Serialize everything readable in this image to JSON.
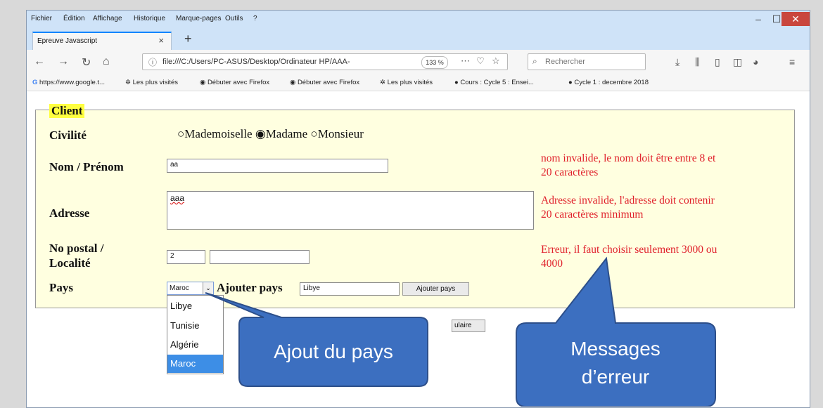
{
  "menubar": {
    "items": [
      "Fichier",
      "Édition",
      "Affichage",
      "Historique",
      "Marque-pages",
      "Outils",
      "?"
    ],
    "minimize": "–",
    "maximize": "☐",
    "close": "✕"
  },
  "tab": {
    "title": "Epreuve Javascript",
    "close": "×",
    "new_tab": "+"
  },
  "navbar": {
    "url": "file:///C:/Users/PC-ASUS/Desktop/Ordinateur HP/AAA-",
    "zoom": "133 %",
    "search_placeholder": "Rechercher"
  },
  "bookmarks": [
    "https://www.google.t...",
    "Les plus visités",
    "Débuter avec Firefox",
    "Débuter avec Firefox",
    "Les plus visités",
    "Cours : Cycle 5 : Ensei...",
    "Cycle 1 : decembre 2018"
  ],
  "form": {
    "legend": "Client",
    "civilite_label": "Civilité",
    "civilite_options": [
      {
        "label": "Mademoiselle",
        "checked": false
      },
      {
        "label": "Madame",
        "checked": true
      },
      {
        "label": "Monsieur",
        "checked": false
      }
    ],
    "nom_label": "Nom / Prénom",
    "nom_value": "aa",
    "adresse_label": "Adresse",
    "adresse_value": "aaa",
    "postal_label_1": "No postal /",
    "postal_label_2": "Localité",
    "postal_value": "2",
    "localite_value": "",
    "pays_label": "Pays",
    "pays_selected": "Maroc",
    "ajouter_label": "Ajouter pays",
    "ajouter_value": "Libye",
    "ajouter_button": "Ajouter pays",
    "submit_partial": "ulaire",
    "pays_options": [
      "Libye",
      "Tunisie",
      "Algérie",
      "Maroc"
    ]
  },
  "errors": {
    "nom_1": "nom invalide, le nom doit être entre 8 et",
    "nom_2": "20 caractères",
    "adresse_1": "Adresse invalide, l'adresse doit contenir",
    "adresse_2": "20 caractères minimum",
    "postal_1": "Erreur, il faut choisir seulement 3000 ou",
    "postal_2": "4000"
  },
  "callouts": {
    "ajout": "Ajout du pays",
    "messages_1": "Messages",
    "messages_2": "d’erreur",
    "color": "#3c6fc0"
  }
}
